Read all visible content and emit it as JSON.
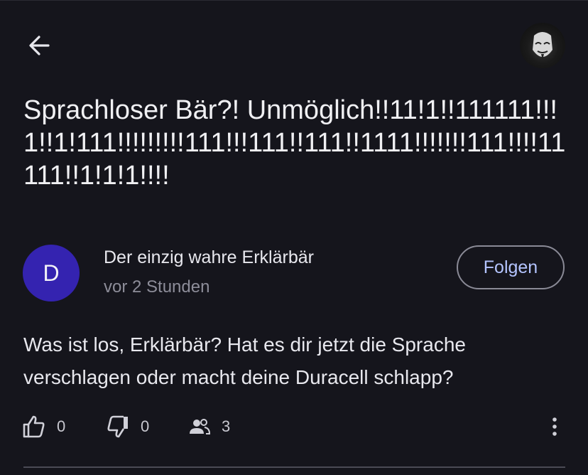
{
  "header": {
    "back_icon": "arrow-left-icon",
    "profile_icon": "avatar-mask"
  },
  "post": {
    "title": "Sprachloser Bär?! Unmöglich!!11!1!!111111!!!1!!1!111!!!!!!!!!111!!!111!!111!!1111!!!!!!!111!!!!11111!!1!1!1!!!!",
    "author": {
      "initial": "D",
      "name": "Der einzig wahre Erklärbär",
      "time": "vor 2 Stunden"
    },
    "follow_label": "Folgen",
    "body": "Was ist los, Erklärbär? Hat es dir jetzt die Sprache verschlagen oder macht deine Duracell schlapp?"
  },
  "actions": {
    "likes": "0",
    "dislikes": "0",
    "participants": "3",
    "icons": [
      "thumb-up-icon",
      "thumb-down-icon",
      "people-icon",
      "more-vert-icon"
    ]
  },
  "colors": {
    "background": "#15151c",
    "avatar": "#3423b0",
    "follow_text": "#b4c4ff"
  }
}
